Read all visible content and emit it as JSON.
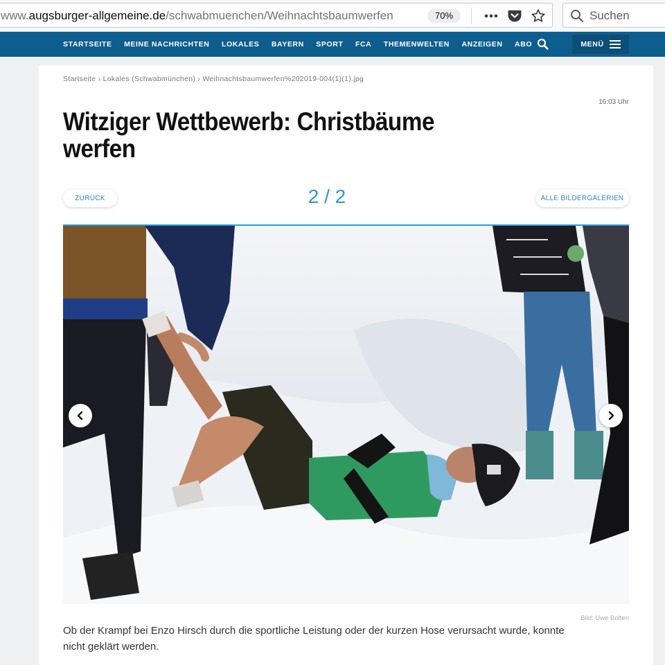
{
  "browser": {
    "url_prefix": "www.",
    "url_domain": "augsburger-allgemeine.de",
    "url_path": "/schwabmuenchen/Weihnachtsbaumwerfen",
    "zoom": "70%",
    "search_placeholder": "Suchen"
  },
  "nav": {
    "items": [
      "STARTSEITE",
      "MEINE NACHRICHTEN",
      "LOKALES",
      "BAYERN",
      "SPORT",
      "FCA",
      "THEMENWELTEN",
      "ANZEIGEN",
      "ABO"
    ],
    "menu_label": "MENÜ"
  },
  "article": {
    "breadcrumb": [
      "Startseite",
      "Lokales (Schwabmünchen)",
      "Weihnachtsbaumwerfen%202019-004(1)(1).jpg"
    ],
    "time": "16:03 Uhr",
    "title": "Witziger Wettbewerb: Christbäume werfen",
    "back_label": "ZURÜCK",
    "pager": "2 / 2",
    "all_galleries_label": "ALLE BILDERGALERIEN",
    "photo_credit": "Bild: Uwe Bolten",
    "caption": "Ob der Krampf bei Enzo Hirsch durch die sportliche Leistung oder der kurzen Hose verursacht wurde, konnte nicht geklärt werden."
  },
  "colors": {
    "nav_bg": "#0d5e8f",
    "accent": "#2b9ad6"
  }
}
